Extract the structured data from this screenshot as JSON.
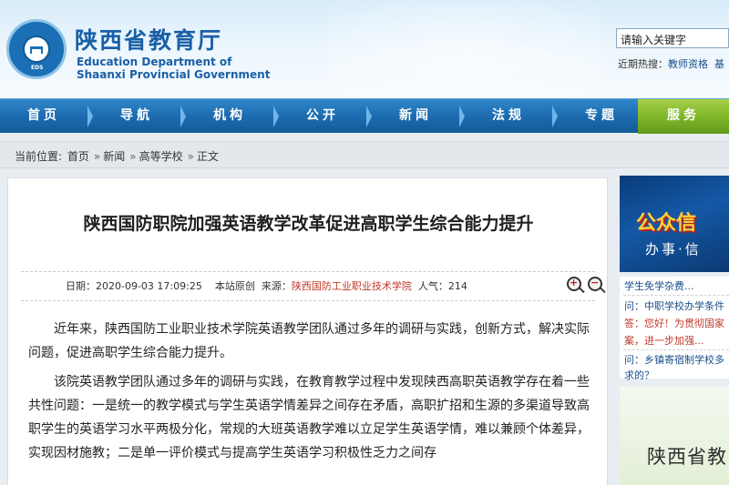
{
  "header": {
    "org_cn": "陕西省教育厅",
    "org_en_line1": "Education Department of",
    "org_en_line2": "Shaanxi Provincial Government",
    "logo_text": "EDS",
    "search_placeholder": "请输入关键字",
    "hot_label": "近期热搜：",
    "hot_items": [
      "教师资格",
      "基"
    ]
  },
  "nav": {
    "items": [
      "首页",
      "导航",
      "机构",
      "公开",
      "新闻",
      "法规",
      "专题",
      "服务"
    ]
  },
  "breadcrumb": {
    "label": "当前位置:",
    "items": [
      "首页",
      "新闻",
      "高等学校",
      "正文"
    ]
  },
  "article": {
    "title": "陕西国防职院加强英语教学改革促进高职学生综合能力提升",
    "date_label": "日期：",
    "date": "2020-09-03 17:09:25",
    "origin": "本站原创",
    "source_label": "来源：",
    "source": "陕西国防工业职业技术学院",
    "views_label": "人气：",
    "views": "214",
    "paragraphs": [
      "近年来，陕西国防工业职业技术学院英语教学团队通过多年的调研与实践，创新方式，解决实际问题，促进高职学生综合能力提升。",
      "该院英语教学团队通过多年的调研与实践，在教育教学过程中发现陕西高职英语教学存在着一些共性问题：一是统一的教学模式与学生英语学情差异之间存在矛盾，高职扩招和生源的多渠道导致高职学生的英语学习水平两极分化，常规的大班英语教学难以立足学生英语学情，难以兼顾个体差异，实现因材施教；二是单一评价模式与提高学生英语学习积极性乏力之间存"
    ]
  },
  "sidebar": {
    "banner_title": "公众信",
    "banner_sub": "办事·信",
    "qa": [
      {
        "text": "学生免学杂费...",
        "kind": "q"
      },
      {
        "text": "问：中职学校办学条件",
        "kind": "q"
      },
      {
        "text": "答：您好！为贯彻国家",
        "kind": "a"
      },
      {
        "text": "案，进一步加强...",
        "kind": "a"
      },
      {
        "text": "问：乡镇寄宿制学校多",
        "kind": "q"
      },
      {
        "text": "求的？",
        "kind": "q"
      }
    ],
    "promo_text": "陕西省教"
  }
}
